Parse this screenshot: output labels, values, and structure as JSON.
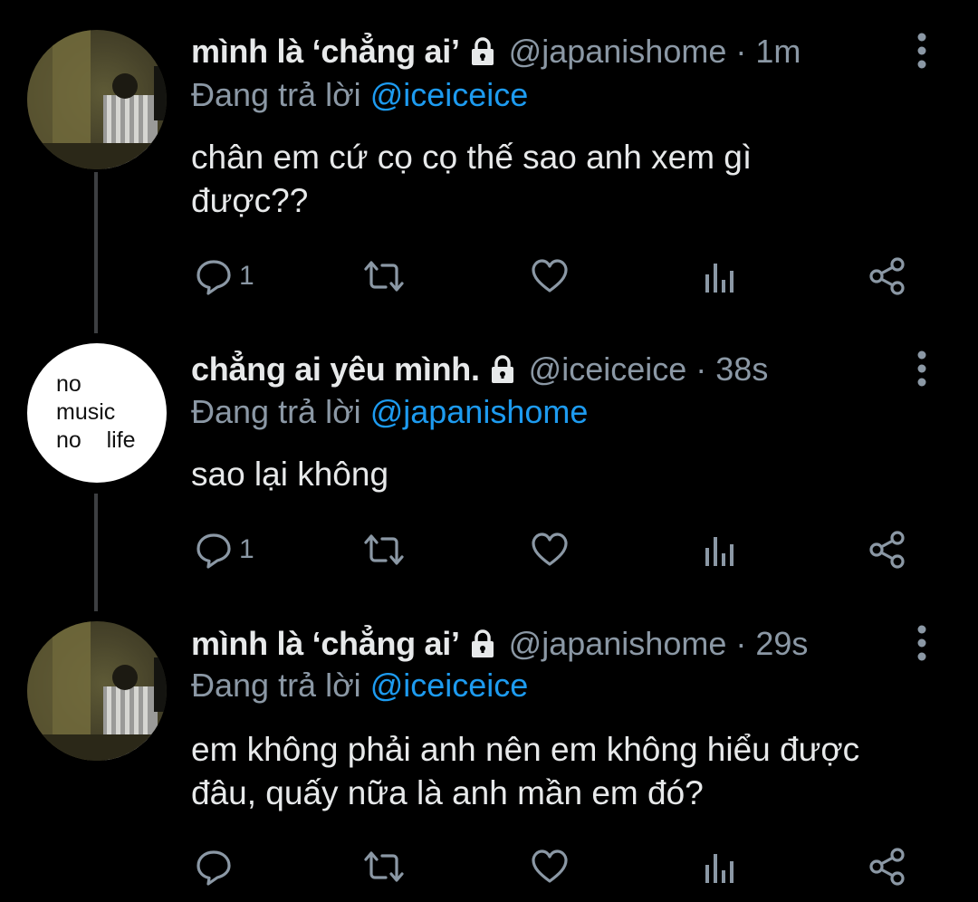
{
  "colors": {
    "background": "#000000",
    "text_primary": "#e7e9ea",
    "text_secondary": "#8b98a5",
    "mention": "#1d9bf0",
    "thread_line": "#3d3f42"
  },
  "tweets": [
    {
      "display_name": "mình là ‘chẳng ai’",
      "protected_icon": "lock-icon",
      "handle": "@japanishome",
      "separator": "·",
      "time": "1m",
      "reply_prefix": "Đang trả lời",
      "reply_to": "@iceiceice",
      "text_lines": [
        "chân em cứ cọ cọ thế sao anh xem gì",
        "được??"
      ],
      "actions": {
        "reply_count": "1",
        "retweet_count": "",
        "like_count": ""
      }
    },
    {
      "display_name": "chẳng ai yêu mình.",
      "protected_icon": "lock-icon",
      "avatar_text": [
        "no",
        "music",
        "no    life"
      ],
      "handle": "@iceiceice",
      "separator": "·",
      "time": "38s",
      "reply_prefix": "Đang trả lời",
      "reply_to": "@japanishome",
      "text_lines": [
        "sao lại không"
      ],
      "actions": {
        "reply_count": "1",
        "retweet_count": "",
        "like_count": ""
      }
    },
    {
      "display_name": "mình là ‘chẳng ai’",
      "protected_icon": "lock-icon",
      "handle": "@japanishome",
      "separator": "·",
      "time": "29s",
      "reply_prefix": "Đang trả lời",
      "reply_to": "@iceiceice",
      "text_lines": [
        "em không phải anh nên em không hiểu được",
        "đâu, quấy nữa là anh mần em đó?"
      ],
      "actions": {
        "reply_count": "",
        "retweet_count": "",
        "like_count": ""
      }
    }
  ]
}
